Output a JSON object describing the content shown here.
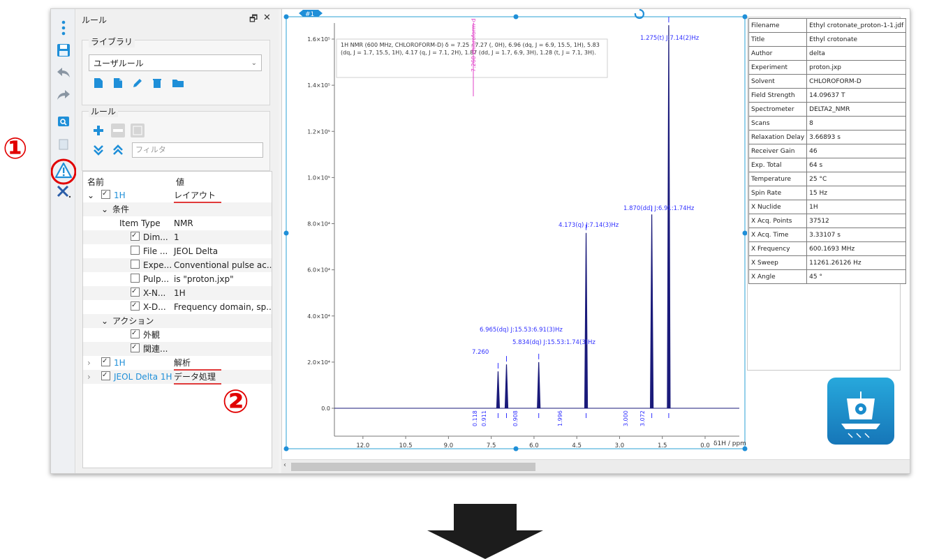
{
  "panel": {
    "title": "ルール",
    "library_label": "ライブラリ",
    "library_selected": "ユーザルール",
    "rules_label": "ルール",
    "filter_placeholder": "フィルタ"
  },
  "tree": {
    "col_name": "名前",
    "col_value": "値",
    "rows": [
      {
        "name": "1H",
        "value": "レイアウト"
      },
      {
        "name": "条件",
        "value": ""
      },
      {
        "name": "Item Type",
        "value": "NMR"
      },
      {
        "name": "Dim...",
        "value": "1"
      },
      {
        "name": "File ...",
        "value": "JEOL Delta"
      },
      {
        "name": "Expe...",
        "value": "Conventional pulse ac..."
      },
      {
        "name": "Pulp...",
        "value": "is \"proton.jxp\""
      },
      {
        "name": "X-N...",
        "value": "1H"
      },
      {
        "name": "X-D...",
        "value": "Frequency domain, sp..."
      },
      {
        "name": "アクション",
        "value": ""
      },
      {
        "name": "外観",
        "value": ""
      },
      {
        "name": "関連...",
        "value": ""
      },
      {
        "name": "1H",
        "value": "解析"
      },
      {
        "name": "JEOL Delta 1H",
        "value": "データ処理"
      }
    ]
  },
  "annotations": {
    "one": "①",
    "two": "②"
  },
  "spectrum": {
    "tab": "#1",
    "description": "1H NMR (600 MHz, CHLOROFORM-D) δ = 7.25 - 7.27 (, 0H), 6.96 (dq, J = 6.9, 15.5, 1H), 5.83 (dq, J = 1.7, 15.5, 1H), 4.17 (q, J = 7.1, 2H), 1.87 (dd, J = 1.7, 6.9, 3H), 1.28 (t, J = 7.1, 3H).",
    "solvent_marker": "7.260 chloroform-d",
    "x_title": "δ1H / ppm",
    "x_ticks": [
      "12.0",
      "10.5",
      "9.0",
      "7.5",
      "6.0",
      "4.5",
      "3.0",
      "1.5",
      "0.0"
    ],
    "y_ticks": [
      "0.0",
      "2.0×10⁴",
      "4.0×10⁴",
      "6.0×10⁴",
      "8.0×10⁴",
      "1.0×10⁵",
      "1.2×10⁵",
      "1.4×10⁵",
      "1.6×10⁵"
    ],
    "peak_labels": {
      "p1": "1.275(t) J:7.14(2)Hz",
      "p2": "1.870(dd) J:6.91:1.74Hz",
      "p3": "4.173(q) J:7.14(3)Hz",
      "p4": "6.965(dq) J:15.53:6.91(3)Hz",
      "p5": "5.834(dq) J:15.53:1.74(3)Hz",
      "p6": "7.260"
    },
    "integrals": {
      "i1": "0.118",
      "i2": "0.911",
      "i3": "0.908",
      "i4": "1.996",
      "i5": "3.000",
      "i6": "3.072"
    }
  },
  "chart_data": {
    "type": "line",
    "xlabel": "δ1H / ppm",
    "xlim": [
      13.0,
      -1.2
    ],
    "ylim": [
      0,
      170000
    ],
    "peaks": [
      {
        "ppm": 7.26,
        "height": 16000
      },
      {
        "ppm": 6.965,
        "height": 19000
      },
      {
        "ppm": 5.834,
        "height": 20000
      },
      {
        "ppm": 4.173,
        "height": 76000
      },
      {
        "ppm": 1.87,
        "height": 84000
      },
      {
        "ppm": 1.275,
        "height": 166000
      }
    ]
  },
  "props": [
    [
      "Filename",
      "Ethyl crotonate_proton-1-1.jdf"
    ],
    [
      "Title",
      "Ethyl crotonate"
    ],
    [
      "Author",
      "delta"
    ],
    [
      "Experiment",
      "proton.jxp"
    ],
    [
      "Solvent",
      "CHLOROFORM-D"
    ],
    [
      "Field Strength",
      "14.09637 T"
    ],
    [
      "Spectrometer",
      "DELTA2_NMR"
    ],
    [
      "Scans",
      "8"
    ],
    [
      "Relaxation Delay",
      "3.66893 s"
    ],
    [
      "Receiver Gain",
      "46"
    ],
    [
      "Exp. Total",
      "64 s"
    ],
    [
      "Temperature",
      "25 °C"
    ],
    [
      "Spin Rate",
      "15 Hz"
    ],
    [
      "X Nuclide",
      "1H"
    ],
    [
      "X Acq. Points",
      "37512"
    ],
    [
      "X Acq. Time",
      "3.33107 s"
    ],
    [
      "X Frequency",
      "600.1693 MHz"
    ],
    [
      "X Sweep",
      "11261.26126 Hz"
    ],
    [
      "X Angle",
      "45 °"
    ]
  ],
  "colors": {
    "accent": "#1f8fd8",
    "spectrum": "#1a1a7a",
    "peak_label": "#3030ff",
    "annotation": "#e10000"
  }
}
